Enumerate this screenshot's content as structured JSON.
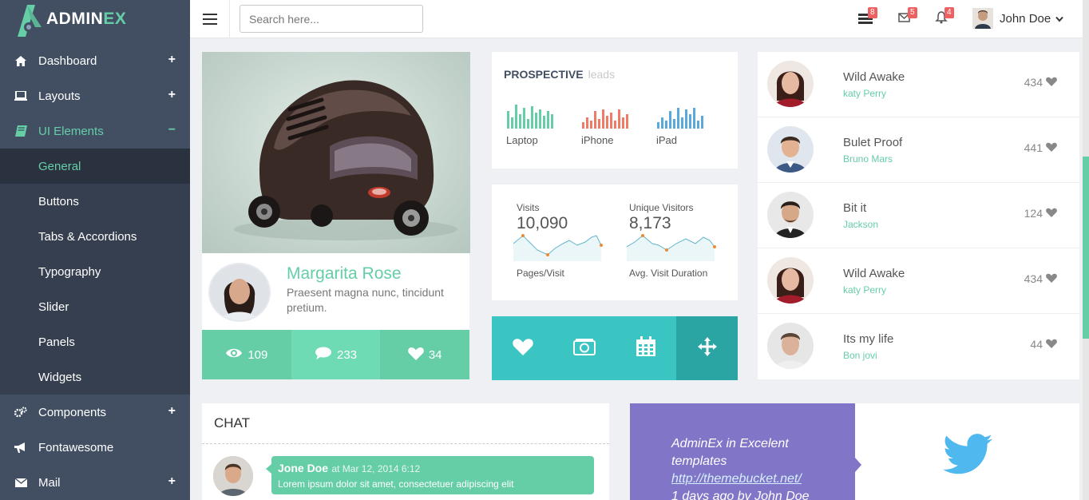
{
  "brand": {
    "name_a": "ADMIN",
    "name_b": "EX"
  },
  "sidebar": {
    "items": [
      {
        "label": "Dashboard",
        "icon": "home-icon",
        "toggle": "+"
      },
      {
        "label": "Layouts",
        "icon": "laptop-icon",
        "toggle": "+"
      },
      {
        "label": "UI Elements",
        "icon": "book-icon",
        "toggle": "−"
      },
      {
        "label": "Components",
        "icon": "cogs-icon",
        "toggle": "+"
      },
      {
        "label": "Fontawesome",
        "icon": "bullhorn-icon",
        "toggle": ""
      },
      {
        "label": "Mail",
        "icon": "envelope-icon",
        "toggle": "+"
      }
    ],
    "sub_items": [
      "General",
      "Buttons",
      "Tabs & Accordions",
      "Typography",
      "Slider",
      "Panels",
      "Widgets"
    ]
  },
  "topbar": {
    "search_placeholder": "Search here...",
    "tasks_count": "8",
    "messages_count": "5",
    "notifications_count": "4",
    "user_name": "John Doe"
  },
  "profile": {
    "name": "Margarita Rose",
    "description": "Praesent magna nunc, tincidunt pretium.",
    "views": "109",
    "comments": "233",
    "likes": "34"
  },
  "prospective": {
    "title": "PROSPECTIVE",
    "subtitle": "leads",
    "devices": [
      "Laptop",
      "iPhone",
      "iPad"
    ]
  },
  "visits": {
    "visits_label": "Visits",
    "visits_value": "10,090",
    "visits_caption": "Pages/Visit",
    "unique_label": "Unique Visitors",
    "unique_value": "8,173",
    "unique_caption": "Avg. Visit Duration"
  },
  "songs": [
    {
      "title": "Wild Awake",
      "artist": "katy Perry",
      "likes": "434"
    },
    {
      "title": "Bulet Proof",
      "artist": "Bruno Mars",
      "likes": "441"
    },
    {
      "title": "Bit it",
      "artist": "Jackson",
      "likes": "124"
    },
    {
      "title": "Wild Awake",
      "artist": "katy Perry",
      "likes": "434"
    },
    {
      "title": "Its my life",
      "artist": "Bon jovi",
      "likes": "44"
    }
  ],
  "chat": {
    "title": "CHAT",
    "sender": "Jone Doe",
    "time": "at Mar 12, 2014 6:12",
    "message": "Lorem ipsum dolor sit amet, consectetuer adipiscing elit"
  },
  "tweet": {
    "line1": "AdminEx in Excelent templates",
    "link": "http://themebucket.net/",
    "footer": "1 days ago by John Doe"
  },
  "colors": {
    "accent": "#65cea7",
    "sidebar": "#424f63",
    "teal": "#3ac4c2",
    "purple": "#8175c7",
    "twitter": "#4fb8ee"
  }
}
